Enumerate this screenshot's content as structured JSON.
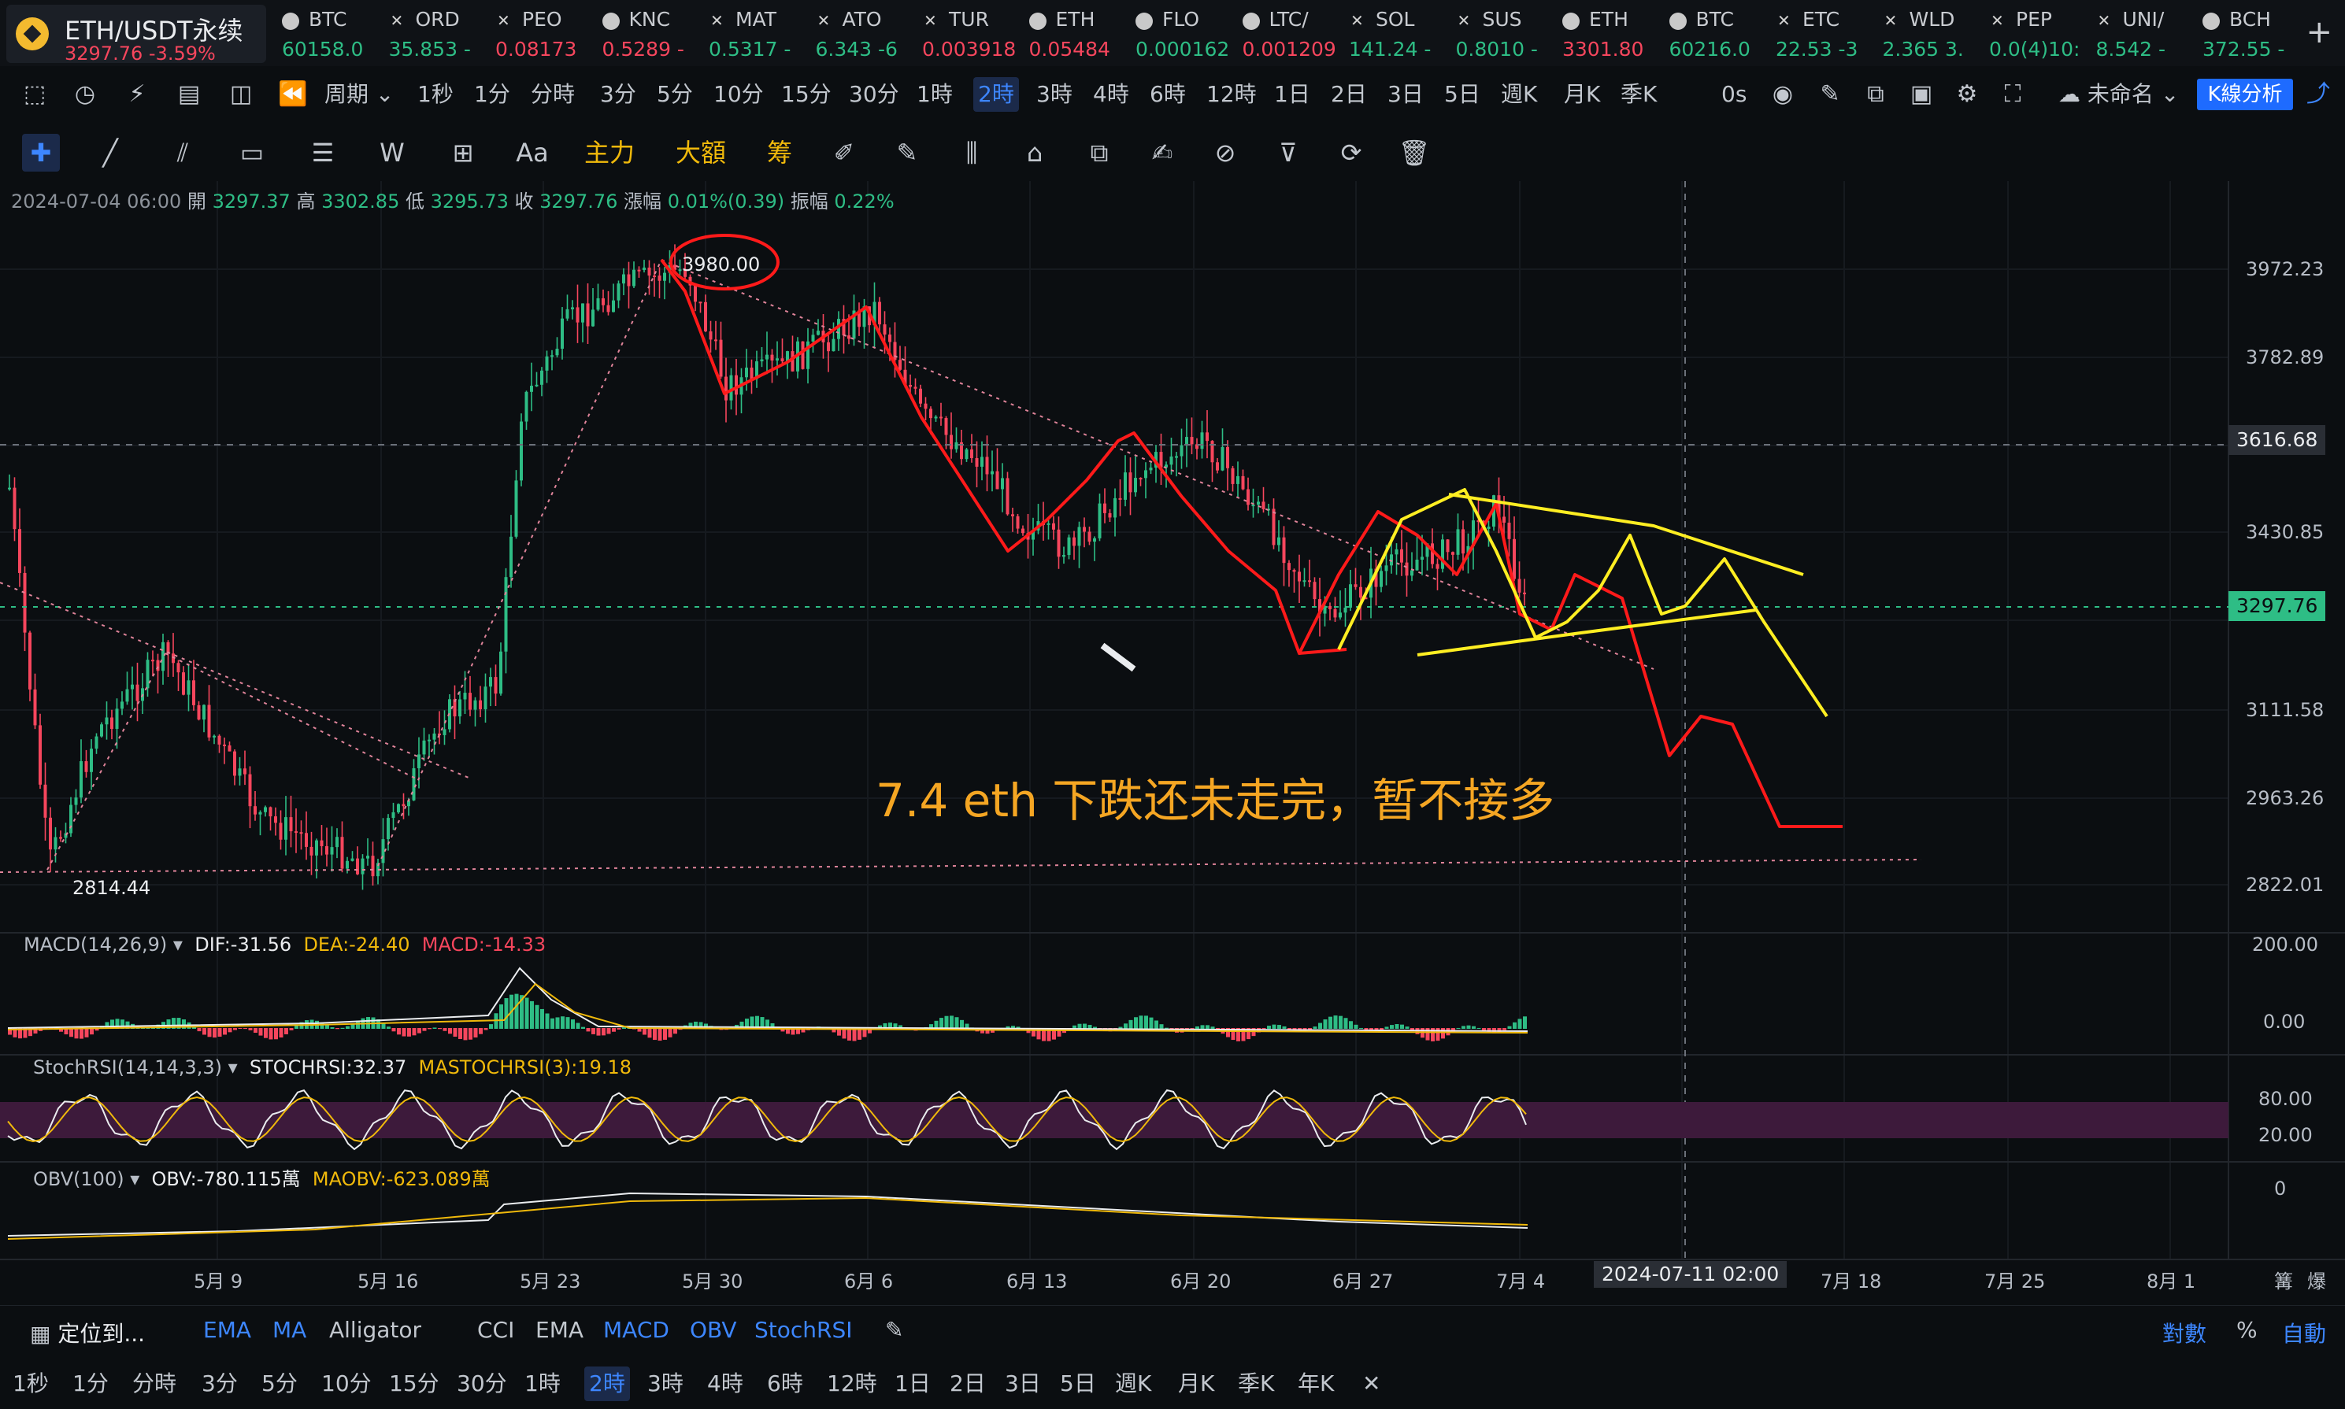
{
  "symbol": {
    "name": "ETH/USDT永续",
    "price": "3297.76",
    "change": "-3.59%"
  },
  "tickers": [
    {
      "sym": "BTC",
      "val": "60158.0",
      "neg": false,
      "icon": "coin-icon"
    },
    {
      "sym": "ORD",
      "val": "35.853 -",
      "neg": false,
      "icon": "x-icon"
    },
    {
      "sym": "PEO",
      "val": "0.08173",
      "neg": true,
      "icon": "x-icon"
    },
    {
      "sym": "KNC",
      "val": "0.5289 -",
      "neg": true,
      "icon": "coin-icon"
    },
    {
      "sym": "MAT",
      "val": "0.5317 -",
      "neg": false,
      "icon": "x-icon"
    },
    {
      "sym": "ATO",
      "val": "6.343 -6",
      "neg": false,
      "icon": "x-icon"
    },
    {
      "sym": "TUR",
      "val": "0.003918",
      "neg": true,
      "icon": "x-icon"
    },
    {
      "sym": "ETH",
      "val": "0.05484",
      "neg": true,
      "icon": "coin-icon"
    },
    {
      "sym": "FLO",
      "val": "0.000162",
      "neg": false,
      "icon": "coin-icon"
    },
    {
      "sym": "LTC/",
      "val": "0.001209",
      "neg": true,
      "icon": "coin-icon"
    },
    {
      "sym": "SOL",
      "val": "141.24 -",
      "neg": false,
      "icon": "x-icon"
    },
    {
      "sym": "SUS",
      "val": "0.8010 -",
      "neg": false,
      "icon": "x-icon"
    },
    {
      "sym": "ETH",
      "val": "3301.80",
      "neg": true,
      "icon": "coin-icon"
    },
    {
      "sym": "BTC",
      "val": "60216.0",
      "neg": false,
      "icon": "coin-icon"
    },
    {
      "sym": "ETC",
      "val": "22.53 -3",
      "neg": false,
      "icon": "x-icon"
    },
    {
      "sym": "WLD",
      "val": "2.365 3.",
      "neg": false,
      "icon": "x-icon"
    },
    {
      "sym": "PEP",
      "val": "0.0(4)10:",
      "neg": false,
      "icon": "x-icon"
    },
    {
      "sym": "UNI/",
      "val": "8.542 -",
      "neg": false,
      "icon": "x-icon"
    },
    {
      "sym": "BCH",
      "val": "372.55 -",
      "neg": false,
      "icon": "coin-icon"
    }
  ],
  "toolbar": {
    "period_label": "周期",
    "intervals": [
      "1秒",
      "1分",
      "分時",
      "3分",
      "5分",
      "10分",
      "15分",
      "30分",
      "1時",
      "2時",
      "3時",
      "4時",
      "6時",
      "12時",
      "1日",
      "2日",
      "3日",
      "5日",
      "週K",
      "月K",
      "季K"
    ],
    "active_interval": "2時",
    "seconds_label": "0s",
    "layout_label": "未命名",
    "kline_label": "K線分析"
  },
  "drawbar": {
    "main_label": "主力",
    "big_label": "大額",
    "chip_label": "筹"
  },
  "ohlc": {
    "time": "2024-07-04 06:00",
    "open_label": "開",
    "open": "3297.37",
    "high_label": "高",
    "high": "3302.85",
    "low_label": "低",
    "low": "3295.73",
    "close_label": "收",
    "close": "3297.76",
    "chg_label": "漲幅",
    "chg": "0.01%(0.39)",
    "amp_label": "振幅",
    "amp": "0.22%"
  },
  "price_axis": [
    "3972.23",
    "3782.89",
    "3430.85",
    "3111.58",
    "2963.26",
    "2822.01"
  ],
  "crosshair_price": "3616.68",
  "last_price": "3297.76",
  "marks": {
    "high": "3980.00",
    "low": "2814.44"
  },
  "annotation": "7.4 eth 下跌还未走完，暂不接多",
  "macd": {
    "title": "MACD(14,26,9)",
    "dif": "DIF:-31.56",
    "dea": "DEA:-24.40",
    "macd": "MACD:-14.33",
    "axis": [
      "200.00",
      "0.00"
    ]
  },
  "stochrsi": {
    "title": "StochRSI(14,14,3,3)",
    "k": "STOCHRSI:32.37",
    "d": "MASTOCHRSI(3):19.18",
    "axis": [
      "80.00",
      "20.00"
    ]
  },
  "obv": {
    "title": "OBV(100)",
    "obv": "OBV:-780.115萬",
    "maobv": "MAOBV:-623.089萬",
    "axis": [
      "0"
    ]
  },
  "time_axis": [
    "5月 9",
    "5月 16",
    "5月 23",
    "5月 30",
    "6月 6",
    "6月 13",
    "6月 20",
    "6月 27",
    "7月 4",
    "7月 18",
    "7月 25",
    "8月 1"
  ],
  "crosshair_time": "2024-07-11 02:00",
  "axis_right": [
    "篝",
    "爆"
  ],
  "indicator_bar": {
    "locate": "定位到...",
    "main": [
      "EMA",
      "MA",
      "Alligator"
    ],
    "sub": [
      "CCI",
      "EMA",
      "MACD",
      "OBV",
      "StochRSI"
    ],
    "right": [
      "對數",
      "%",
      "自動"
    ]
  },
  "bottom_intervals": [
    "1秒",
    "1分",
    "分時",
    "3分",
    "5分",
    "10分",
    "15分",
    "30分",
    "1時",
    "2時",
    "3時",
    "4時",
    "6時",
    "12時",
    "1日",
    "2日",
    "3日",
    "5日",
    "週K",
    "月K",
    "季K",
    "年K"
  ],
  "colors": {
    "up": "#2ebd85",
    "down": "#f6465d",
    "accent": "#1e6bff",
    "annotation": "#f5a623",
    "drawing_red": "#ff1a1a",
    "drawing_yellow": "#ffee22"
  }
}
